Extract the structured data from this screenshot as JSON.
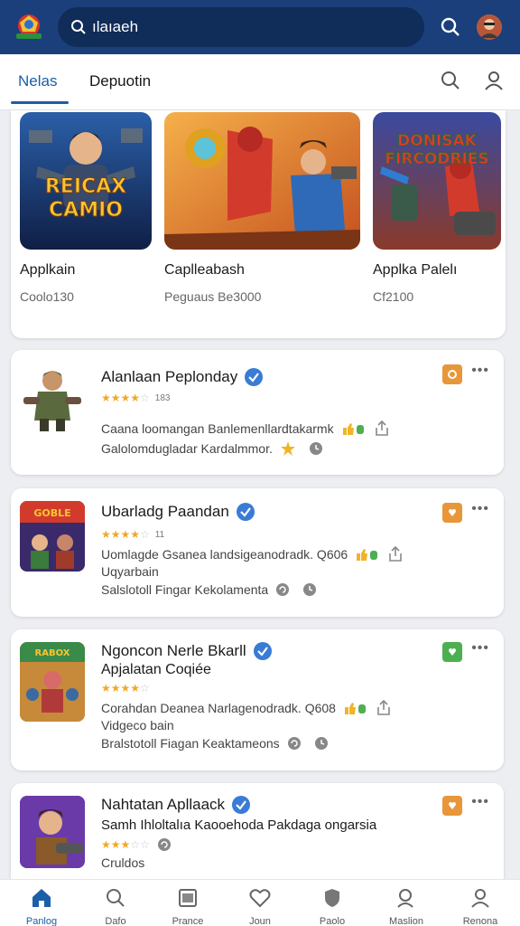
{
  "search": {
    "value": "ılaıaeh"
  },
  "tabs": [
    {
      "label": "Nelas",
      "active": true
    },
    {
      "label": "Depuotin",
      "active": false
    }
  ],
  "featured": [
    {
      "banner_text": "REICAX CAMIO",
      "title": "Applkain",
      "subtitle": "Coolo130"
    },
    {
      "banner_text": "",
      "title": "Caplleabash",
      "subtitle": "Peguaus Be3000"
    },
    {
      "banner_text": "DONISAK FIRCODRIES",
      "title": "Applka Palelı",
      "subtitle": "Cf2100"
    }
  ],
  "apps": [
    {
      "name": "Alanlaan Peplonday",
      "rating_count": "183",
      "line1": "Caana loomangan Banlemenllardtakarmk",
      "line2": "Galolomdugladar Kardalmmor.",
      "badge_color": "#e8963a"
    },
    {
      "name": "Ubarladg Paandan",
      "rating_count": "11",
      "line1": "Uomlagde Gsanea landsigeanodradk. Q606",
      "line2": "Uqyarbain",
      "line3": "Salslotoll Fingar Kekolamenta",
      "badge_color": "#e8963a"
    },
    {
      "name": "Ngoncon Nerle Bkarll",
      "name2": "Apjalatan Coqiée",
      "line1": "Corahdan Deanea Narlagenodradk. Q608",
      "line2": "Vidgeco bain",
      "line3": "Bralstotoll Fiagan Keaktameons",
      "badge_color": "#4caf50"
    },
    {
      "name": "Nahtatan Apllaack",
      "name2": "Samh Ihloltalıa Kaooehoda Pakdaga ongarsia",
      "line1": "Cruldos",
      "badge_color": "#e8963a"
    }
  ],
  "nav": [
    {
      "label": "Panlog",
      "icon": "home-icon",
      "active": true
    },
    {
      "label": "Dafo",
      "icon": "search-icon"
    },
    {
      "label": "Prance",
      "icon": "window-icon"
    },
    {
      "label": "Joun",
      "icon": "heart-icon"
    },
    {
      "label": "Paolo",
      "icon": "shield-icon"
    },
    {
      "label": "Maslion",
      "icon": "person-search-icon"
    },
    {
      "label": "Renona",
      "icon": "person-icon"
    }
  ],
  "colors": {
    "brand": "#1a3f7a",
    "accent": "#1a5fa8",
    "star": "#f0a828",
    "verified": "#3a7bd5"
  }
}
